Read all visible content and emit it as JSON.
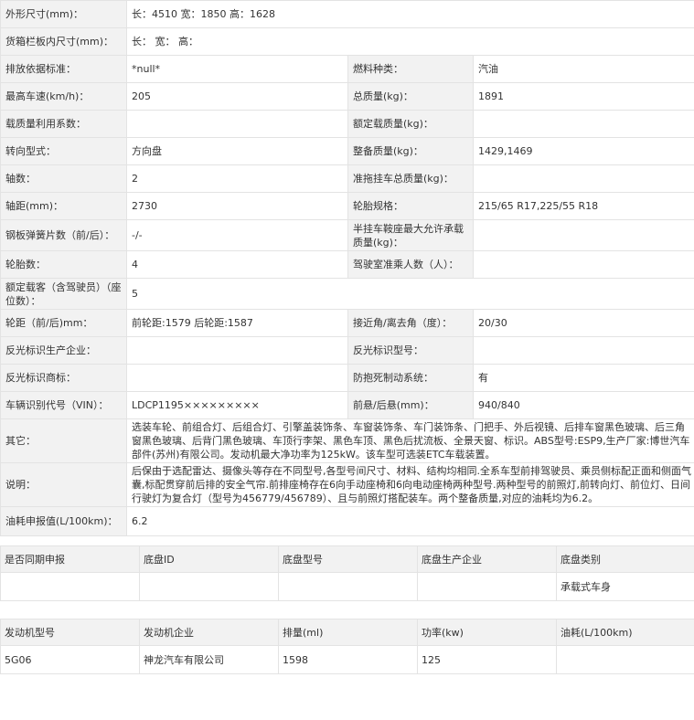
{
  "spec": {
    "dims": {
      "label": "外形尺寸(mm)：",
      "value": "长：4510 宽：1850 高：1628"
    },
    "cargo": {
      "label": "货箱栏板内尺寸(mm)：",
      "value": "长： 宽： 高："
    },
    "emission": {
      "label": "排放依据标准：",
      "value": "*null*"
    },
    "fuel": {
      "label": "燃料种类：",
      "value": "汽油"
    },
    "maxspeed": {
      "label": "最高车速(km/h)：",
      "value": "205"
    },
    "totalmass": {
      "label": "总质量(kg)：",
      "value": "1891"
    },
    "loadcoef": {
      "label": "载质量利用系数：",
      "value": ""
    },
    "ratedload": {
      "label": "额定载质量(kg)：",
      "value": ""
    },
    "steering": {
      "label": "转向型式：",
      "value": "方向盘"
    },
    "curbmass": {
      "label": "整备质量(kg)：",
      "value": "1429,1469"
    },
    "axles": {
      "label": "轴数：",
      "value": "2"
    },
    "trailer": {
      "label": "准拖挂车总质量(kg)：",
      "value": ""
    },
    "wheelbase": {
      "label": "轴距(mm)：",
      "value": "2730"
    },
    "tire": {
      "label": "轮胎规格：",
      "value": "215/65 R17,225/55 R18"
    },
    "spring": {
      "label": "钢板弹簧片数（前/后）：",
      "value": "-/-"
    },
    "saddle": {
      "label": "半挂车鞍座最大允许承载质量(kg)：",
      "value": ""
    },
    "tires": {
      "label": "轮胎数：",
      "value": "4"
    },
    "cab": {
      "label": "驾驶室准乘人数（人）：",
      "value": ""
    },
    "seats": {
      "label": "额定载客（含驾驶员）（座位数）：",
      "value": "5"
    },
    "track": {
      "label": "轮距（前/后)mm：",
      "value": "前轮距:1579 后轮距:1587"
    },
    "angle": {
      "label": "接近角/离去角（度）：",
      "value": "20/30"
    },
    "refmaker": {
      "label": "反光标识生产企业：",
      "value": ""
    },
    "refmodel": {
      "label": "反光标识型号：",
      "value": ""
    },
    "refbrand": {
      "label": "反光标识商标：",
      "value": ""
    },
    "abs": {
      "label": "防抱死制动系统：",
      "value": "有"
    },
    "vin": {
      "label": "车辆识别代号（VIN）：",
      "value": "LDCP1195×××××××××"
    },
    "overhang": {
      "label": "前悬/后悬(mm)：",
      "value": "940/840"
    },
    "other": {
      "label": "其它：",
      "value": "选装车轮、前组合灯、后组合灯、引擎盖装饰条、车窗装饰条、车门装饰条、门把手、外后视镜、后排车窗黑色玻璃、后三角窗黑色玻璃、后背门黑色玻璃、车顶行李架、黑色车顶、黑色后扰流板、全景天窗、标识。ABS型号:ESP9,生产厂家:博世汽车部件(苏州)有限公司。发动机最大净功率为125kW。该车型可选装ETC车载装置。"
    },
    "note": {
      "label": "说明：",
      "value": "后保由于选配雷达、摄像头等存在不同型号,各型号间尺寸、材料、结构均相同.全系车型前排驾驶员、乘员侧标配正面和侧面气囊,标配贯穿前后排的安全气帘.前排座椅存在6向手动座椅和6向电动座椅两种型号.两种型号的前照灯,前转向灯、前位灯、日间行驶灯为复合灯（型号为456779/456789）、且与前照灯搭配装车。两个整备质量,对应的油耗均为6.2。"
    },
    "fuelcons": {
      "label": "油耗申报值(L/100km)：",
      "value": "6.2"
    }
  },
  "chassis": {
    "headers": [
      "是否同期申报",
      "底盘ID",
      "底盘型号",
      "底盘生产企业",
      "底盘类别"
    ],
    "values": [
      "",
      "",
      "",
      "",
      "承载式车身"
    ]
  },
  "engine": {
    "headers": [
      "发动机型号",
      "发动机企业",
      "排量(ml)",
      "功率(kw)",
      "油耗(L/100km)"
    ],
    "values": [
      "5G06",
      "神龙汽车有限公司",
      "1598",
      "125",
      ""
    ]
  }
}
